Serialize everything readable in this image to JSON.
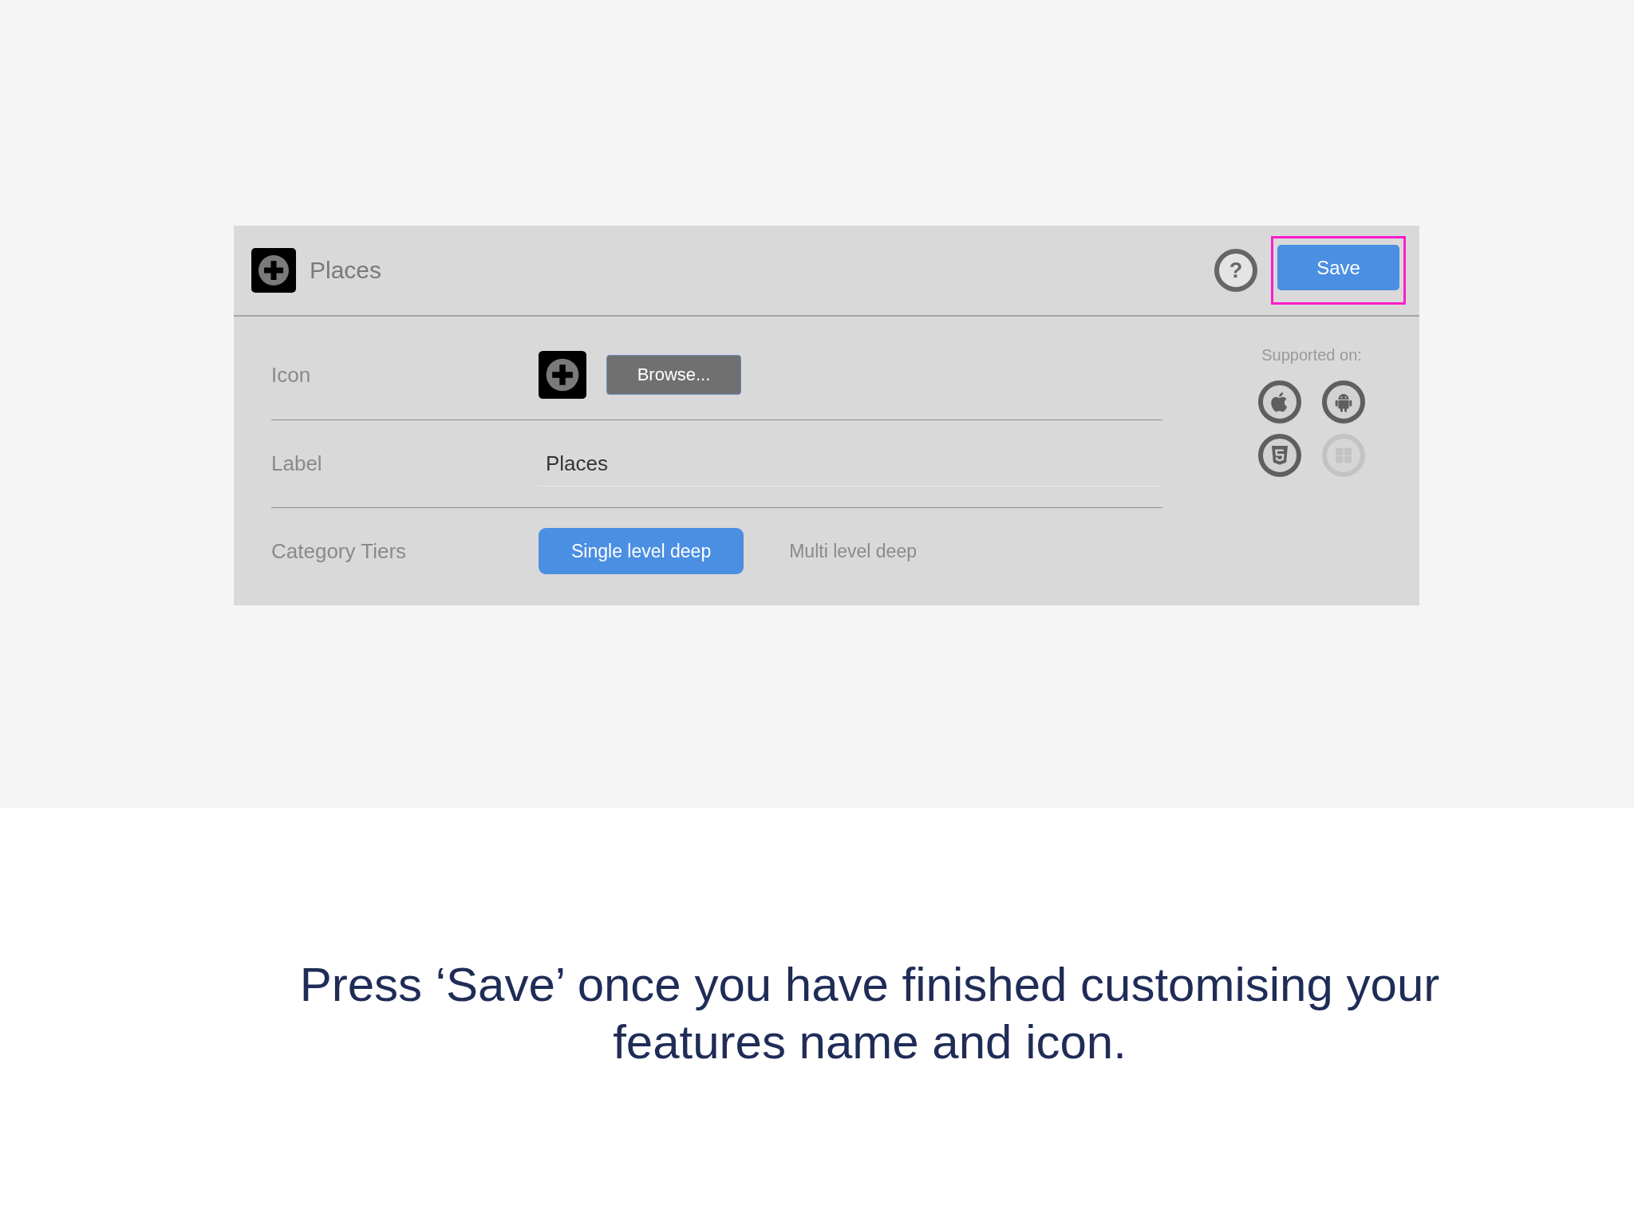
{
  "header": {
    "title": "Places",
    "help": {
      "label": "?"
    },
    "save": {
      "label": "Save",
      "highlighted": true
    }
  },
  "rows": [
    {
      "kind": "icon",
      "label": "Icon",
      "button": "Browse..."
    },
    {
      "kind": "text",
      "label": "Label",
      "value": "Places"
    },
    {
      "kind": "choice",
      "label": "Category Tiers",
      "options": [
        {
          "label": "Single level deep",
          "selected": true
        },
        {
          "label": "Multi level deep",
          "selected": false
        }
      ]
    }
  ],
  "supported": {
    "title": "Supported on:",
    "platforms": [
      {
        "kind": "apple",
        "supported": true
      },
      {
        "kind": "android",
        "supported": true
      },
      {
        "kind": "html5",
        "supported": true
      },
      {
        "kind": "windows",
        "supported": false
      }
    ]
  },
  "caption": "Press ‘Save’ once you have finished customising your features name and icon."
}
